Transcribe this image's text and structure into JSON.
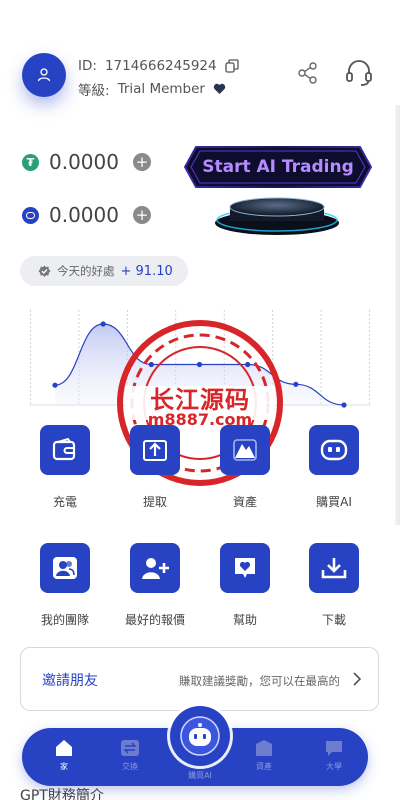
{
  "header": {
    "id_label": "ID:",
    "id_value": "1714666245924",
    "level_label": "等級:",
    "level_value": "Trial Member"
  },
  "balances": [
    {
      "amount": "0.0000",
      "coin_icon": "tether-icon",
      "color": "#26a17b"
    },
    {
      "amount": "0.0000",
      "coin_icon": "coin-icon",
      "color": "#2742c3"
    }
  ],
  "trade_button": {
    "label": "Start AI Trading"
  },
  "today_profit": {
    "label": "今天的好處",
    "value": "+ 91.10"
  },
  "chart_data": {
    "type": "line",
    "x": [
      1,
      2,
      3,
      4,
      5,
      6,
      7
    ],
    "values": [
      22,
      90,
      45,
      45,
      45,
      23,
      0
    ],
    "ylim": [
      0,
      100
    ],
    "grid": true
  },
  "actions_row1": [
    {
      "label": "充電",
      "icon": "wallet-icon"
    },
    {
      "label": "提取",
      "icon": "withdraw-icon"
    },
    {
      "label": "資產",
      "icon": "asset-icon"
    },
    {
      "label": "購買AI",
      "icon": "robot-icon"
    }
  ],
  "actions_row2": [
    {
      "label": "我的團隊",
      "icon": "team-icon"
    },
    {
      "label": "最好的報價",
      "icon": "add-user-icon"
    },
    {
      "label": "幫助",
      "icon": "help-heart-icon"
    },
    {
      "label": "下載",
      "icon": "download-icon"
    }
  ],
  "invite": {
    "title": "邀請朋友",
    "desc": "賺取建議獎勵，您可以在最高的"
  },
  "section_title": "GPT財務簡介",
  "nav": {
    "items": [
      {
        "label": "家",
        "icon": "home-icon",
        "active": true
      },
      {
        "label": "交換",
        "icon": "exchange-icon",
        "active": false
      },
      {
        "label": "購買AI",
        "icon": "robot-icon",
        "active": false
      },
      {
        "label": "資產",
        "icon": "asset-icon",
        "active": false
      },
      {
        "label": "大學",
        "icon": "chat-icon",
        "active": false
      }
    ]
  },
  "watermark": {
    "line1": "长江源码",
    "line2": "m8887.com",
    "color": "#d8252a"
  },
  "colors": {
    "primary": "#2742c3",
    "accent": "#b48cff"
  }
}
